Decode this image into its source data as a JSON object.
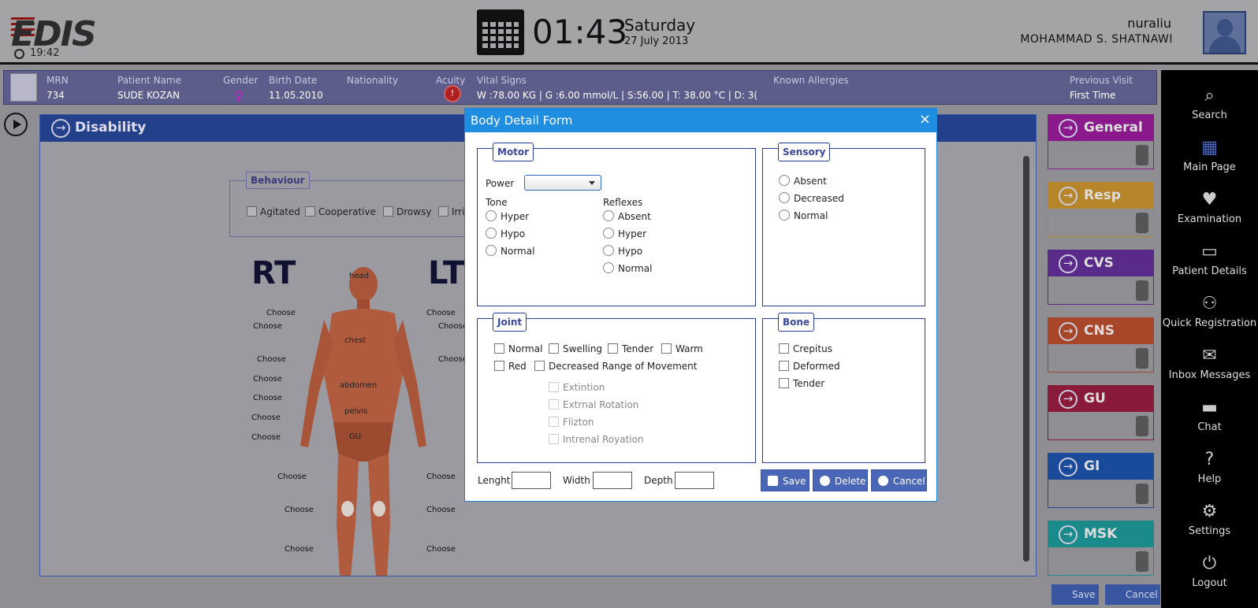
{
  "header": {
    "logo_text": "EDIS",
    "small_time": "19:42",
    "time": "01:43",
    "day": "Saturday",
    "date": "27 July 2013",
    "username": "nuraliu",
    "full_name": "MOHAMMAD S.  SHATNAWI"
  },
  "patient_bar": {
    "labels": {
      "mrn": "MRN",
      "name": "Patient Name",
      "gender": "Gender",
      "birth": "Birth Date",
      "nationality": "Nationality",
      "acuity": "Acuity",
      "vitals": "Vital Signs",
      "allergies": "Known Allergies",
      "previous": "Previous Visit"
    },
    "mrn": "734",
    "name": "SUDE KOZAN",
    "birth_date": "11.05.2010",
    "acuity_value": "!",
    "vital_signs": "W :78.00 KG | G :6.00 mmol/L  | S:56.00 |  T: 38.00 °C  |  D: 3(",
    "previous_visit": "First Time"
  },
  "sidebar": [
    {
      "label": "Search",
      "icon": "search-icon"
    },
    {
      "label": "Main Page",
      "icon": "grid-icon"
    },
    {
      "label": "Examination",
      "icon": "stethoscope-icon"
    },
    {
      "label": "Patient Details",
      "icon": "id-card-icon"
    },
    {
      "label": "Quick Registration",
      "icon": "user-plus-icon"
    },
    {
      "label": "Inbox Messages",
      "icon": "envelope-icon"
    },
    {
      "label": "Chat",
      "icon": "chat-icon"
    },
    {
      "label": "Help",
      "icon": "help-icon"
    },
    {
      "label": "Settings",
      "icon": "gear-icon"
    },
    {
      "label": "Logout",
      "icon": "power-icon"
    }
  ],
  "main": {
    "title": "Disability",
    "behaviour_title": "Behaviour",
    "behaviour_items": [
      "Agitated",
      "Cooperative",
      "Drowsy",
      "Irri"
    ],
    "rt": "RT",
    "lt": "LT",
    "choose": "Choose",
    "body_labels": [
      "head",
      "chest",
      "abdomen",
      "pelvis",
      "GU"
    ]
  },
  "cards": [
    {
      "title": "General",
      "color": "#8a1a8c"
    },
    {
      "title": "Resp",
      "color": "#b8862a"
    },
    {
      "title": "CVS",
      "color": "#5a2a8a"
    },
    {
      "title": "CNS",
      "color": "#a8462a"
    },
    {
      "title": "GU",
      "color": "#8a1a3a"
    },
    {
      "title": "GI",
      "color": "#1a4a9a"
    },
    {
      "title": "MSK",
      "color": "#1a8a8a"
    }
  ],
  "bottom_buttons": {
    "save": "Save",
    "cancel": "Cancel"
  },
  "modal": {
    "title": "Body Detail Form",
    "close": "×",
    "motor": {
      "title": "Motor",
      "power_label": "Power",
      "tone_label": "Tone",
      "tone_options": [
        "Hyper",
        "Hypo",
        "Normal"
      ],
      "reflexes_label": "Reflexes",
      "reflex_options": [
        "Absent",
        "Hyper",
        "Hypo",
        "Normal"
      ]
    },
    "sensory": {
      "title": "Sensory",
      "options": [
        "Absent",
        "Decreased",
        "Normal"
      ]
    },
    "joint": {
      "title": "Joint",
      "row1": [
        "Normal",
        "Swelling",
        "Tender",
        "Warm"
      ],
      "red": "Red",
      "decreased": "Decreased Range of Movement",
      "sub_options": [
        "Extintion",
        "Extrnal Rotation",
        "Flizton",
        "Intrenal Royation"
      ]
    },
    "bone": {
      "title": "Bone",
      "options": [
        "Crepitus",
        "Deformed",
        "Tender"
      ]
    },
    "dims": {
      "length": "Lenght",
      "width": "Width",
      "depth": "Depth"
    },
    "buttons": {
      "save": "Save",
      "delete": "Delete",
      "cancel": "Cancel"
    }
  }
}
